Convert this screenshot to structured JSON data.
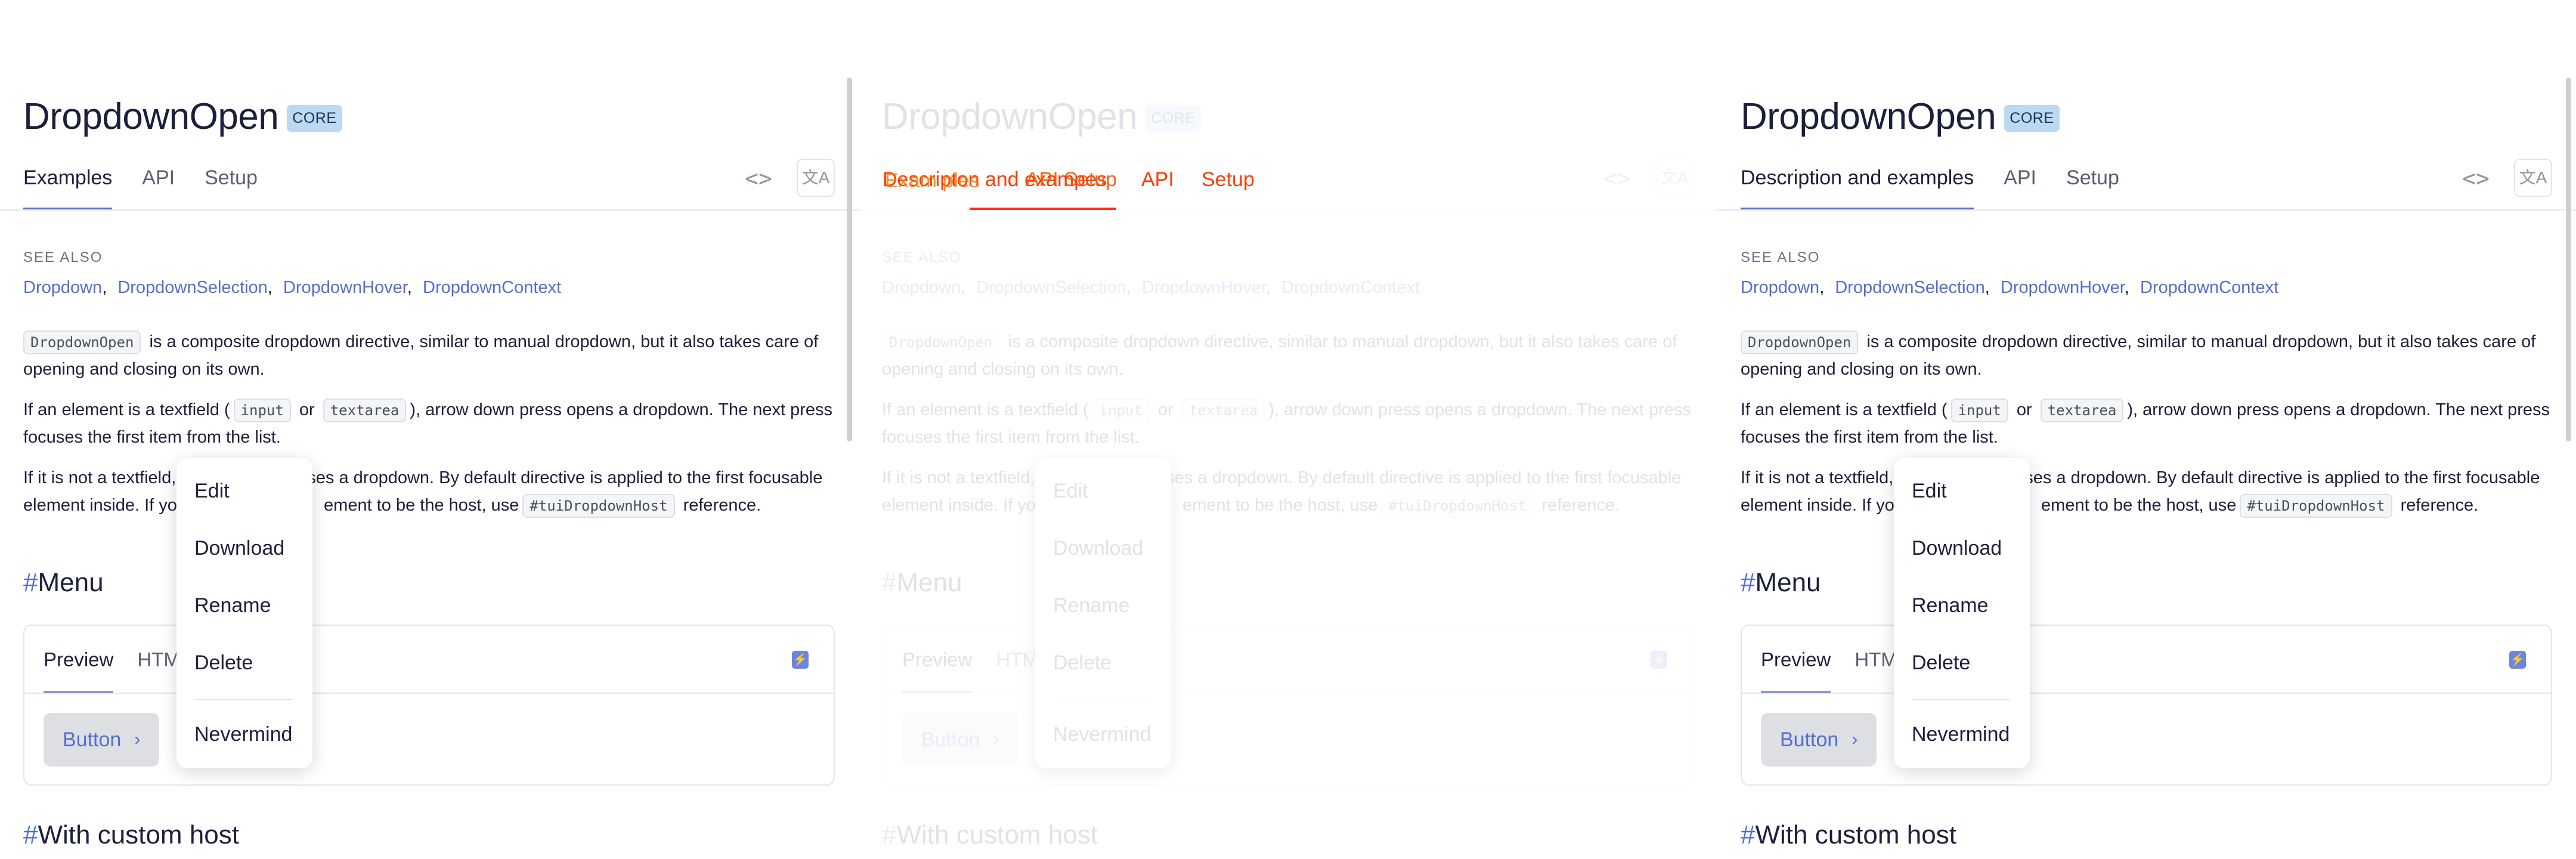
{
  "page": {
    "title": "DropdownOpen",
    "badge": "CORE",
    "tabs_left": [
      "Examples",
      "API",
      "Setup"
    ],
    "tabs_right": [
      "Description and examples",
      "API",
      "Setup"
    ],
    "code_icon": "<>",
    "translate_icon": "文A",
    "see_also_label": "SEE ALSO",
    "see_also": [
      "Dropdown",
      "DropdownSelection",
      "DropdownHover",
      "DropdownContext"
    ],
    "para1": {
      "chip": "DropdownOpen",
      "text": " is a composite dropdown directive, similar to manual dropdown, but it also takes care of opening and closing on its own."
    },
    "para2": {
      "pre": "If an element is a textfield (",
      "chip1": "input",
      "mid": " or ",
      "chip2": "textarea",
      "post": "), arrow down press opens a dropdown. The next press focuses the first item from the list."
    },
    "para3": {
      "line1_pre": "If it is not a textfield,",
      "line1_post": "ses a dropdown. By default directive is applied to the first focusable",
      "line2_pre": "element inside. If you",
      "line2_mid": "ement to be the host, use",
      "chip": "#tuiDropdownHost",
      "line2_post": " reference."
    },
    "section_menu": "Menu",
    "section_custom": "With custom host",
    "hash": "#",
    "demo": {
      "tabs": [
        "Preview",
        "HTM"
      ],
      "ghost_tab": "t",
      "button_label": "Button",
      "button_chevron": "›",
      "bolt_icon": "⚡"
    },
    "dropdown_items": [
      "Edit",
      "Download",
      "Rename",
      "Delete",
      "Nevermind"
    ],
    "overlay": {
      "glitch_a": "Descripton and exampes",
      "glitch_b": "Exam ples",
      "glitch_c": "API   Setup",
      "api": "API",
      "setup": "Setup"
    }
  }
}
